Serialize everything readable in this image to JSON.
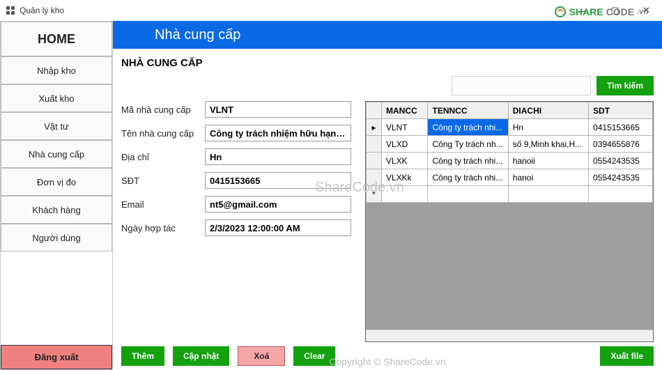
{
  "window": {
    "title": "Quản lý kho"
  },
  "watermark": {
    "share": "SHARE",
    "code": "CODE",
    "vn": ".vn",
    "center": "ShareCode.vn",
    "bottom": "Copyright © ShareCode.vn"
  },
  "sidebar": {
    "home": "HOME",
    "items": [
      "Nhập kho",
      "Xuất kho",
      "Vật tư",
      "Nhà cung cấp",
      "Đơn vị đo",
      "Khách hàng",
      "Người dùng"
    ],
    "logout": "Đăng xuất"
  },
  "header": {
    "title": "Nhà cung cấp"
  },
  "section": {
    "title": "NHÀ CUNG CẤP"
  },
  "search": {
    "value": "",
    "button": "Tìm kiếm"
  },
  "form": {
    "mancc": {
      "label": "Mã nhà cung cấp",
      "value": "VLNT"
    },
    "tenncc": {
      "label": "Tên nhà cung cấp",
      "value": "Công ty trách nhiệm hữu hạn vật"
    },
    "diachi": {
      "label": "Địa chỉ",
      "value": "Hn"
    },
    "sdt": {
      "label": "SĐT",
      "value": "0415153665"
    },
    "email": {
      "label": "Email",
      "value": "nt5@gmail.com"
    },
    "ngay": {
      "label": "Ngày hợp tác",
      "value": "2/3/2023 12:00:00 AM"
    }
  },
  "grid": {
    "cols": [
      "MANCC",
      "TENNCC",
      "DIACHI",
      "SDT"
    ],
    "rows": [
      {
        "head": "▸",
        "cells": [
          "VLNT",
          "Công ty trách nhi...",
          "Hn",
          "0415153665"
        ],
        "sel": 1
      },
      {
        "head": "",
        "cells": [
          "VLXD",
          "Công Ty trách nh...",
          "số 9,Minh khai,H...",
          "0394655876"
        ]
      },
      {
        "head": "",
        "cells": [
          "VLXK",
          "Công ty trách nhi...",
          "hanoii",
          "0554243535"
        ]
      },
      {
        "head": "",
        "cells": [
          "VLXKk",
          "Công ty trách nhi...",
          "hanoi",
          "0554243535"
        ]
      }
    ]
  },
  "actions": {
    "add": "Thêm",
    "update": "Cập nhật",
    "delete": "Xoá",
    "clear": "Clear",
    "export": "Xuất file"
  }
}
